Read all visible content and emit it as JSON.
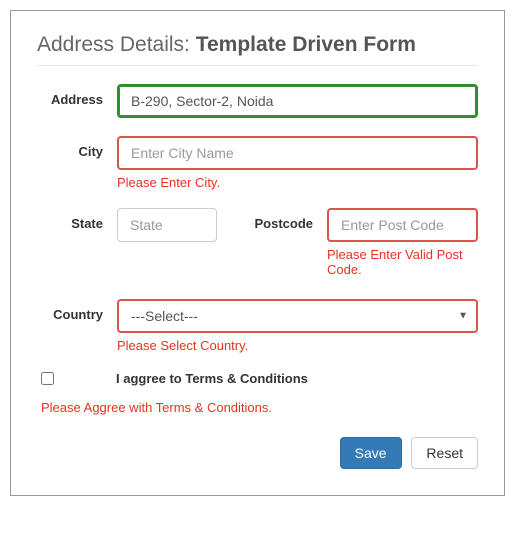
{
  "heading_prefix": "Address Details: ",
  "heading_bold": "Template Driven Form",
  "fields": {
    "address": {
      "label": "Address",
      "value": "B-290, Sector-2, Noida",
      "placeholder": ""
    },
    "city": {
      "label": "City",
      "value": "",
      "placeholder": "Enter City Name",
      "error": "Please Enter City."
    },
    "state": {
      "label": "State",
      "value": "",
      "placeholder": "State"
    },
    "postcode": {
      "label": "Postcode",
      "value": "",
      "placeholder": "Enter Post Code",
      "error": "Please Enter Valid Post Code."
    },
    "country": {
      "label": "Country",
      "selected": "---Select---",
      "error": "Please Select Country."
    }
  },
  "agree": {
    "label": "I aggree to Terms & Conditions",
    "checked": false,
    "error": "Please Aggree with Terms & Conditions."
  },
  "buttons": {
    "save": "Save",
    "reset": "Reset"
  }
}
